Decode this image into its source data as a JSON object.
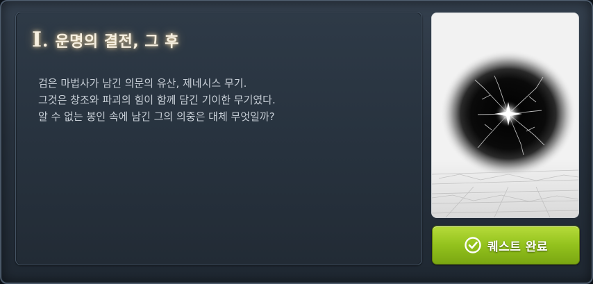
{
  "quest": {
    "chapter_numeral": "I",
    "chapter_separator": ".",
    "chapter_title": "운명의 결전, 그 후",
    "description": [
      "검은 마법사가 남긴 의문의 유산, 제네시스 무기.",
      "그것은 창조와 파괴의 힘이 함께 담긴 기이한 무기였다.",
      "알 수 없는 봉인 속에 남긴 그의 의중은 대체 무엇일까?"
    ]
  },
  "card": {
    "icon": "dark-orb-icon",
    "accent": "#0a0a0a",
    "background": "#f2f2f2"
  },
  "action": {
    "complete_label": "퀘스트 완료",
    "icon": "check-circle-icon",
    "color": "#93c21d"
  }
}
